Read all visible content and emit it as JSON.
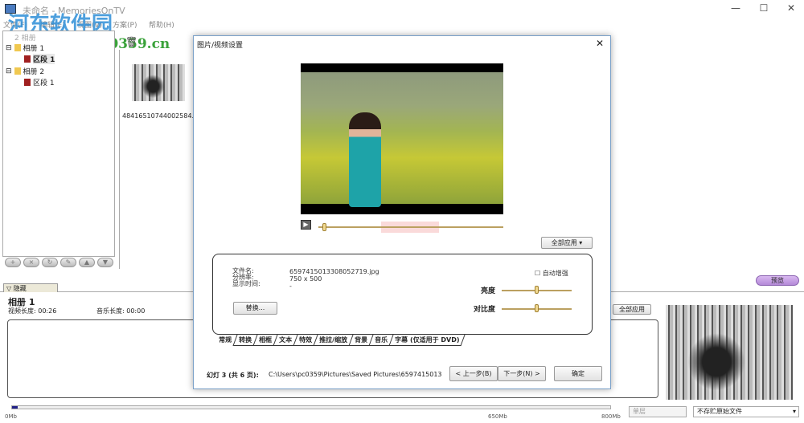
{
  "window": {
    "title": "未命名 - MemoriesOnTV",
    "minimize": "—",
    "maximize": "☐",
    "close": "✕"
  },
  "menu": [
    "文件(F)",
    "编辑(E)",
    "视图(V)",
    "方案(P)",
    "帮助(H)"
  ],
  "tree": {
    "root": "2 相册",
    "items": [
      {
        "label": "相册 1",
        "child": "区段 1"
      },
      {
        "label": "相册 2",
        "child": "区段 1"
      }
    ]
  },
  "thumbnail": {
    "name": "48416510744002584..."
  },
  "watermark": {
    "title": "河东软件园",
    "url": "www.pc0359.cn"
  },
  "lower": {
    "hide_tab": "隐藏",
    "album_title": "相册 1",
    "video_length": "视频长度: 00:26",
    "music_length": "音乐长度: 00:00",
    "apply_all": "全部应用",
    "preview": "预览",
    "layer": "单层",
    "store": "不存贮原始文件",
    "ticks": [
      "0Mb",
      "650Mb",
      "800Mb"
    ],
    "usage_percent": 1
  },
  "dialog": {
    "title": "图片/视频设置",
    "close": "✕",
    "apply_all": "全部应用",
    "labels": {
      "filename": "文件名:",
      "resolution": "分辨率:",
      "duration": "显示时间:"
    },
    "values": {
      "filename": "6597415013308052719.jpg",
      "resolution": "750 x 500",
      "duration": "-"
    },
    "replace": "替换...",
    "auto_enhance": "自动增强",
    "brightness": "亮度",
    "contrast": "对比度",
    "brightness_value": 0.5,
    "contrast_value": 0.5,
    "playback_position": 0.02,
    "tabs": [
      "常规",
      "转换",
      "相框",
      "文本",
      "特效",
      "推拉/缩放",
      "背景",
      "音乐",
      "字幕 (仅适用于 DVD)"
    ],
    "slide_info": "幻灯 3 (共 6 页):",
    "path": "C:\\Users\\pc0359\\Pictures\\Saved Pictures\\6597415013",
    "prev": "< 上一步(B)",
    "next": "下一步(N) >",
    "ok": "确定"
  }
}
